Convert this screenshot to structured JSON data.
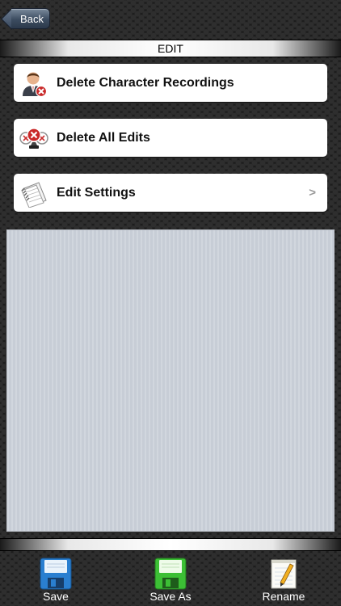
{
  "header": {
    "back_label": "Back",
    "title": "EDIT"
  },
  "menu": {
    "items": [
      {
        "label": "Delete Character Recordings",
        "icon": "user-delete-icon",
        "chevron": ""
      },
      {
        "label": "Delete All Edits",
        "icon": "delete-edits-icon",
        "chevron": ""
      },
      {
        "label": "Edit Settings",
        "icon": "settings-notebook-icon",
        "chevron": ">"
      }
    ]
  },
  "tabbar": {
    "items": [
      {
        "label": "Save",
        "icon": "floppy-disk-blue-icon"
      },
      {
        "label": "Save As",
        "icon": "floppy-disk-green-icon"
      },
      {
        "label": "Rename",
        "icon": "notepad-pencil-icon"
      }
    ]
  },
  "colors": {
    "back_button": "#3c4c60",
    "panel": "#cbd1da",
    "save_icon": "#2a7fd0",
    "save_as_icon": "#3cbf35"
  }
}
